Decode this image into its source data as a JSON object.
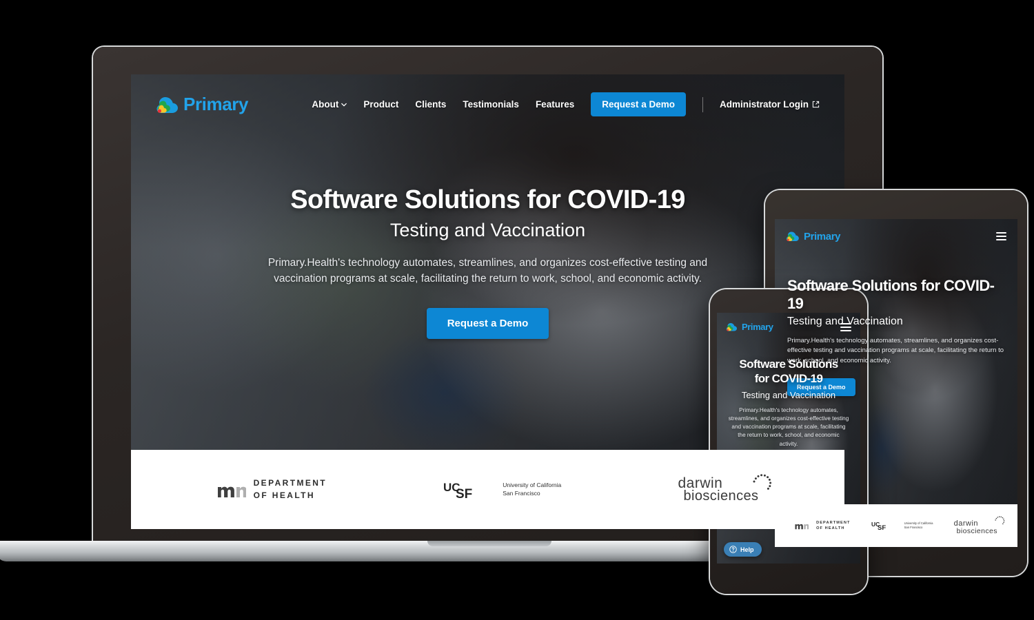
{
  "brand": {
    "name": "Primary",
    "logo_icon": "primary-cloud-logo-icon",
    "accent_color": "#0d87d4",
    "logo_text_color": "#22a3ea"
  },
  "nav": {
    "links": [
      {
        "label": "About",
        "has_dropdown": true,
        "icon": "chevron-down-icon"
      },
      {
        "label": "Product",
        "has_dropdown": false
      },
      {
        "label": "Clients",
        "has_dropdown": false
      },
      {
        "label": "Testimonials",
        "has_dropdown": false
      },
      {
        "label": "Features",
        "has_dropdown": false
      }
    ],
    "cta_label": "Request a Demo",
    "admin_label": "Administrator Login",
    "admin_icon": "external-link-icon",
    "menu_icon": "hamburger-menu-icon"
  },
  "hero": {
    "title": "Software Solutions for COVID-19",
    "subtitle": "Testing and Vaccination",
    "body": "Primary.Health's technology automates, streamlines, and organizes cost-effective testing and vaccination programs at scale, facilitating the return to work, school, and economic activity.",
    "cta_label": "Request a Demo"
  },
  "hero_mobile": {
    "title_line1": "Software Solutions",
    "title_line2": "for COVID-19",
    "subtitle": "Testing and Vaccination",
    "body": "Primary.Health's technology automates, streamlines, and organizes cost-effective testing and vaccination programs at scale, facilitating the return to work, school, and economic activity.",
    "cta_label": "Request a Demo"
  },
  "clients": [
    {
      "id": "mn-dept-health",
      "name_line1": "DEPARTMENT",
      "name_line2": "OF HEALTH",
      "mark": "mn-monogram-icon"
    },
    {
      "id": "ucsf",
      "mark": "ucsf-wordmark-icon",
      "name_line1": "University of California",
      "name_line2": "San Francisco"
    },
    {
      "id": "darwin-biosciences",
      "name_line1": "darwin",
      "name_line2": "biosciences",
      "mark": "darwin-arc-icon"
    }
  ],
  "help_widget": {
    "label": "Help",
    "icon": "question-circle-icon"
  },
  "devices": [
    {
      "id": "laptop",
      "type": "laptop-mockup"
    },
    {
      "id": "tablet",
      "type": "tablet-mockup"
    },
    {
      "id": "phone",
      "type": "phone-mockup"
    }
  ]
}
